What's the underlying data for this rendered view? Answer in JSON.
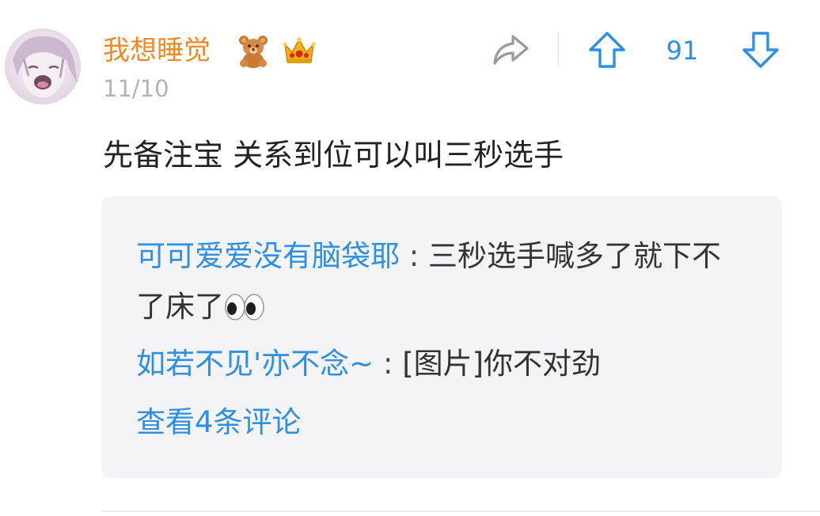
{
  "comment": {
    "username": "我想睡觉",
    "badges": [
      "teddy-bear-icon",
      "crown-icon"
    ],
    "date": "11/10",
    "text": "先备注宝 关系到位可以叫三秒选手",
    "actions": {
      "share_icon": "share-arrow-icon",
      "upvote_icon": "arrow-up-icon",
      "vote_count": "91",
      "downvote_icon": "arrow-down-icon"
    }
  },
  "replies": [
    {
      "author": "可可爱爱没有脑袋耶",
      "separator": " : ",
      "text": "三秒选手喊多了就下不了床了",
      "emoji": "eyes-emoji"
    },
    {
      "author": "如若不见'亦不念~",
      "separator": " : ",
      "text": "[图片]你不对劲"
    }
  ],
  "view_more": "查看4条评论",
  "colors": {
    "username": "#f08a24",
    "link_blue": "#2f8fe0",
    "date_gray": "#b4b4b4",
    "reply_bg": "#f4f4f6"
  }
}
